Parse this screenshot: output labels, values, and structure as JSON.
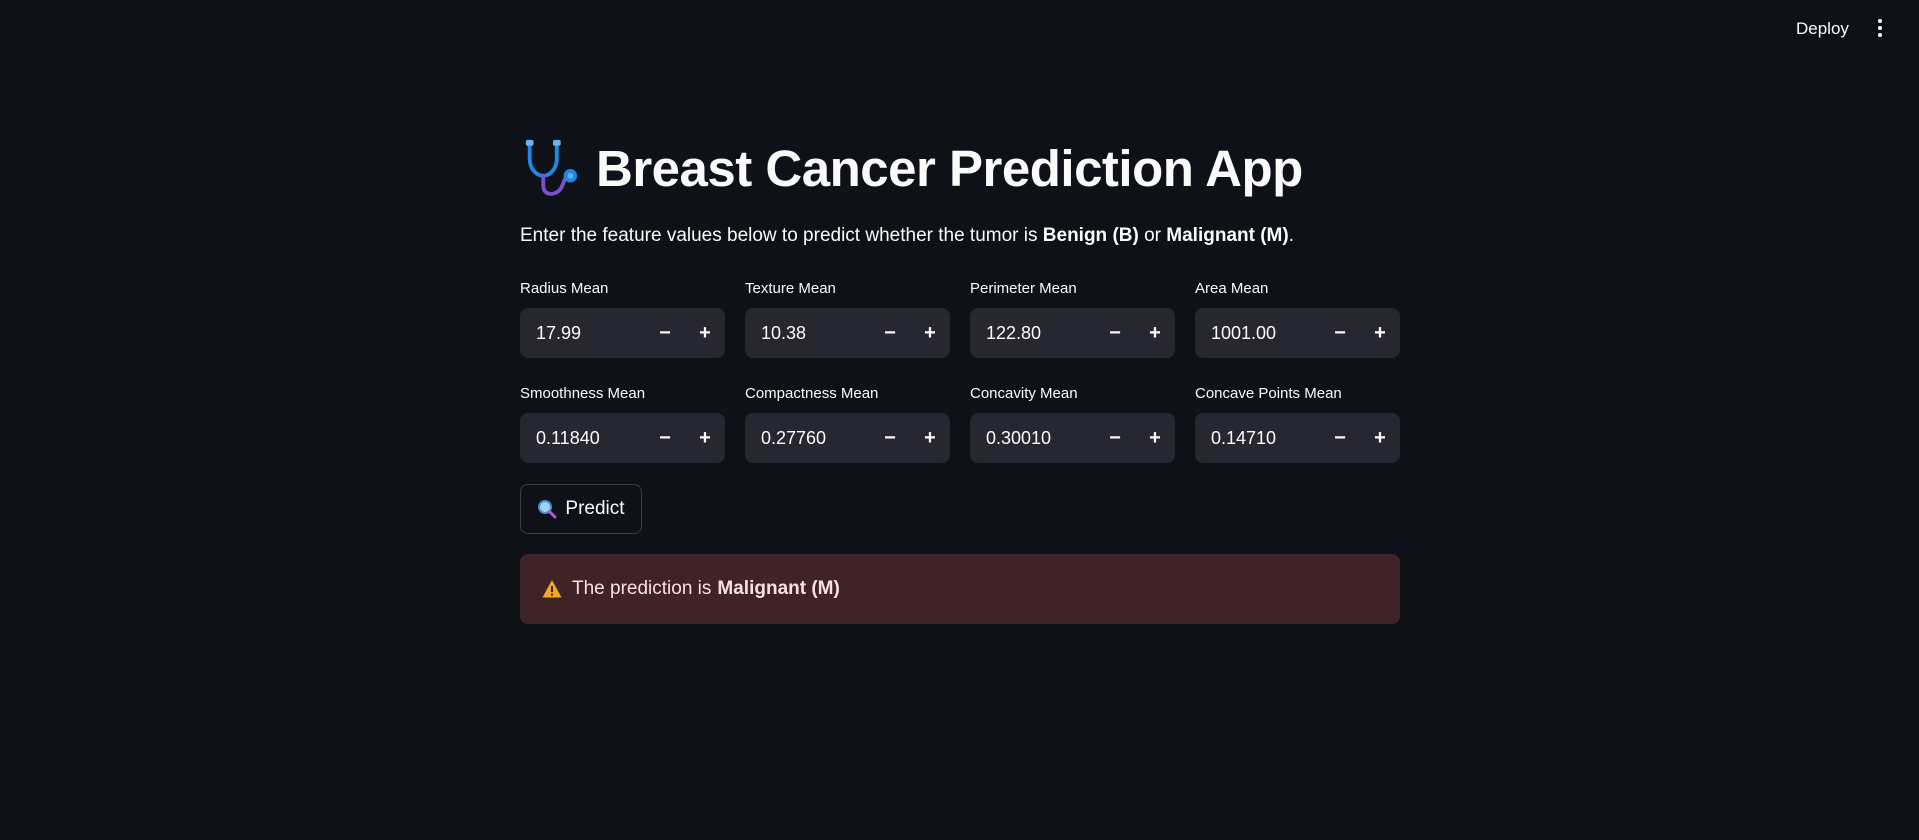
{
  "header": {
    "deploy_label": "Deploy",
    "menu_icon": "kebab-menu-icon"
  },
  "page": {
    "title_icon": "stethoscope-icon",
    "title": "Breast Cancer Prediction App",
    "subtitle_prefix": "Enter the feature values below to predict whether the tumor is ",
    "subtitle_benign": "Benign (B)",
    "subtitle_or": " or ",
    "subtitle_malignant": "Malignant (M)",
    "subtitle_suffix": "."
  },
  "fields": [
    {
      "label": "Radius Mean",
      "value": "17.99"
    },
    {
      "label": "Texture Mean",
      "value": "10.38"
    },
    {
      "label": "Perimeter Mean",
      "value": "122.80"
    },
    {
      "label": "Area Mean",
      "value": "1001.00"
    },
    {
      "label": "Smoothness Mean",
      "value": "0.11840"
    },
    {
      "label": "Compactness Mean",
      "value": "0.27760"
    },
    {
      "label": "Concavity Mean",
      "value": "0.30010"
    },
    {
      "label": "Concave Points Mean",
      "value": "0.14710"
    }
  ],
  "stepper": {
    "minus": "−",
    "plus": "+"
  },
  "predict": {
    "icon": "magnifier-icon",
    "label": "Predict"
  },
  "result": {
    "icon": "warning-icon",
    "prefix": "The prediction is",
    "value": "Malignant (M)"
  },
  "colors": {
    "background": "#0e1117",
    "input_bg": "#262730",
    "alert_bg": "#3e2327",
    "alert_text": "#ffdede"
  }
}
